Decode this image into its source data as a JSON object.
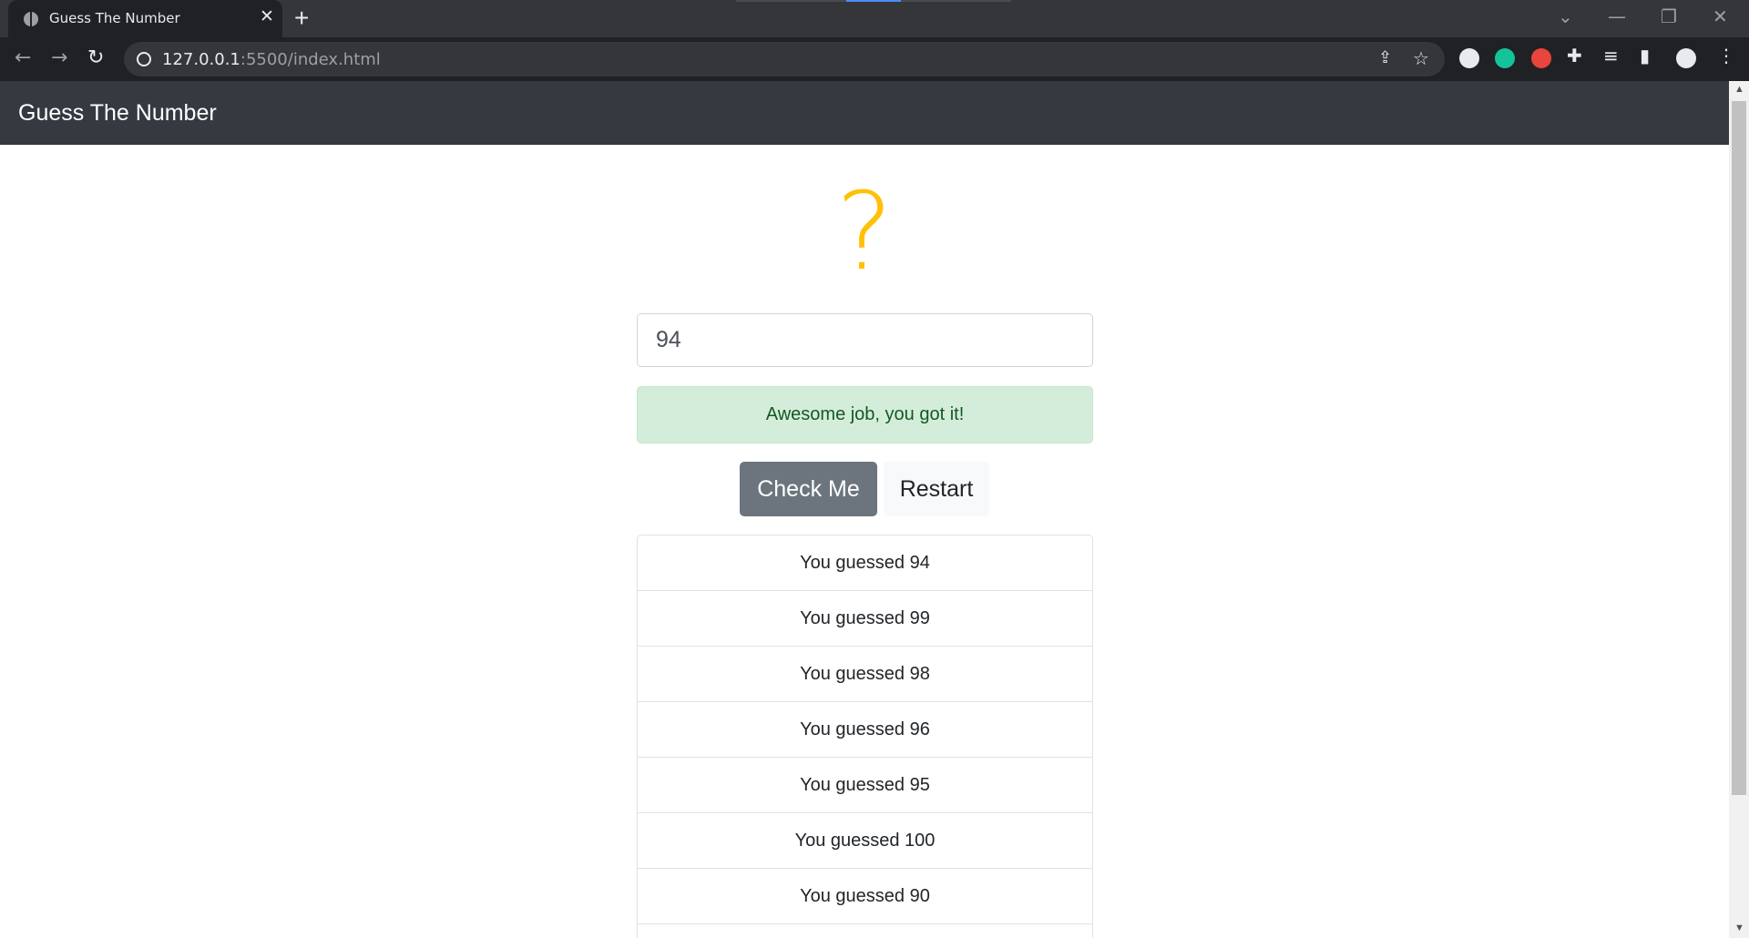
{
  "browser": {
    "tab_title": "Guess The Number",
    "new_tab": "+",
    "tab_close": "✕",
    "url_host": "127.0.0.1",
    "url_rest": ":5500/index.html",
    "window_controls": {
      "dropdown": "⌄",
      "minimize": "—",
      "restore": "❐",
      "close": "✕"
    }
  },
  "page": {
    "brand": "Guess The Number",
    "mystery": "?",
    "input_value": "94",
    "alert": "Awesome job, you got it!",
    "check_button": "Check Me",
    "restart_button": "Restart",
    "guesses": [
      "You guessed 94",
      "You guessed 99",
      "You guessed 98",
      "You guessed 96",
      "You guessed 95",
      "You guessed 100",
      "You guessed 90",
      ""
    ]
  },
  "colors": {
    "navbar": "#343a40",
    "mystery": "#ffc107",
    "alert_bg": "#d4edda",
    "alert_text": "#155724",
    "check_button_bg": "#6c757d"
  }
}
